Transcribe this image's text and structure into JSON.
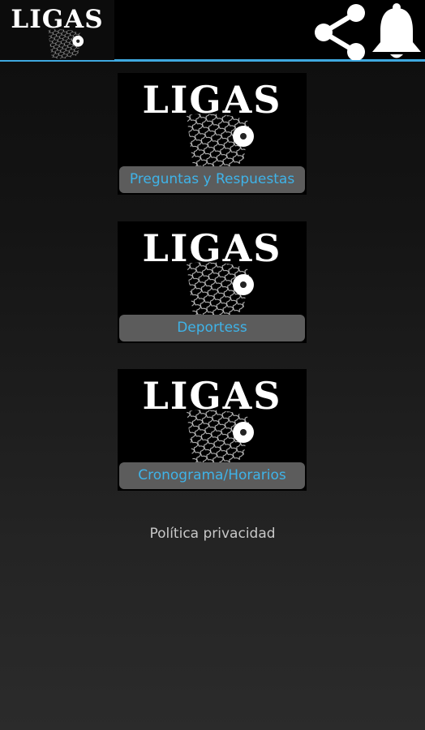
{
  "header": {
    "logo_text": "LIGAS",
    "share_icon": "share-icon",
    "notification_icon": "bell-icon",
    "accent_color": "#3fa9e0"
  },
  "menu": [
    {
      "logo_text": "LIGAS",
      "label": "Preguntas y Respuestas"
    },
    {
      "logo_text": "LIGAS",
      "label": "Deportess"
    },
    {
      "logo_text": "LIGAS",
      "label": "Cronograma/Horarios"
    }
  ],
  "footer": {
    "privacy_label": "Política privacidad"
  }
}
